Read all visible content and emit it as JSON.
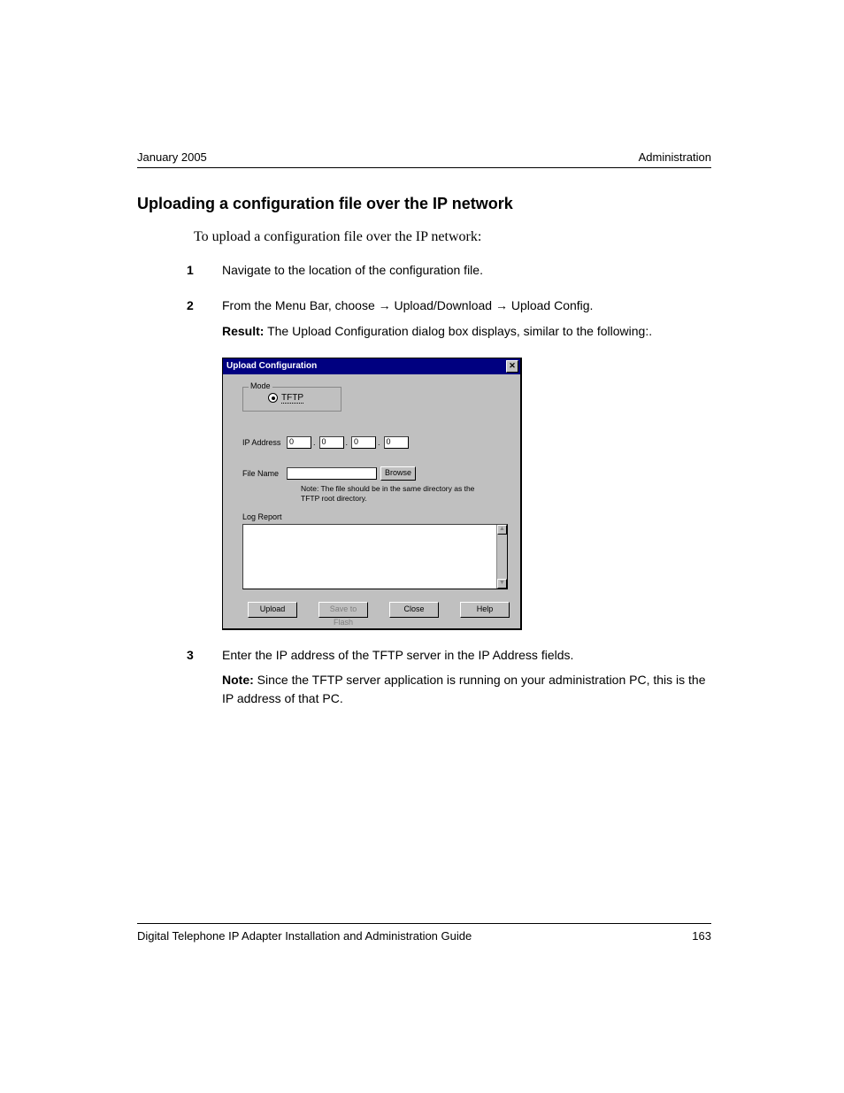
{
  "header": {
    "left": "January 2005",
    "right": "Administration"
  },
  "heading": "Uploading a configuration file over the IP network",
  "intro": "To upload a configuration file over the IP network:",
  "steps": {
    "s1": {
      "num": "1",
      "text": "Navigate to the location of the configuration file."
    },
    "s2": {
      "num": "2",
      "line1_a": "From the Menu Bar, choose ",
      "line1_b": " Upload/Download ",
      "line1_c": " Upload Config.",
      "arrow": "→",
      "result_label": "Result:",
      "result_text": " The Upload Configuration dialog box displays, similar to the following:."
    },
    "s3": {
      "num": "3",
      "text": "Enter the IP address of the TFTP server in the IP Address fields.",
      "note_label": "Note:",
      "note_text": " Since the TFTP server application is running on your administration PC, this is the IP address of that PC."
    }
  },
  "dialog": {
    "title": "Upload Configuration",
    "mode_label": "Mode",
    "tftp": "TFTP",
    "ip_label": "IP Address",
    "ip": [
      "0",
      "0",
      "0",
      "0"
    ],
    "file_label": "File Name",
    "browse": "Browse",
    "note": "Note: The file should be in the same directory as the TFTP root directory.",
    "log_label": "Log Report",
    "buttons": {
      "upload": "Upload",
      "save": "Save to Flash",
      "close": "Close",
      "help": "Help"
    }
  },
  "footer": {
    "title": "Digital Telephone IP Adapter Installation and Administration Guide",
    "page": "163"
  }
}
